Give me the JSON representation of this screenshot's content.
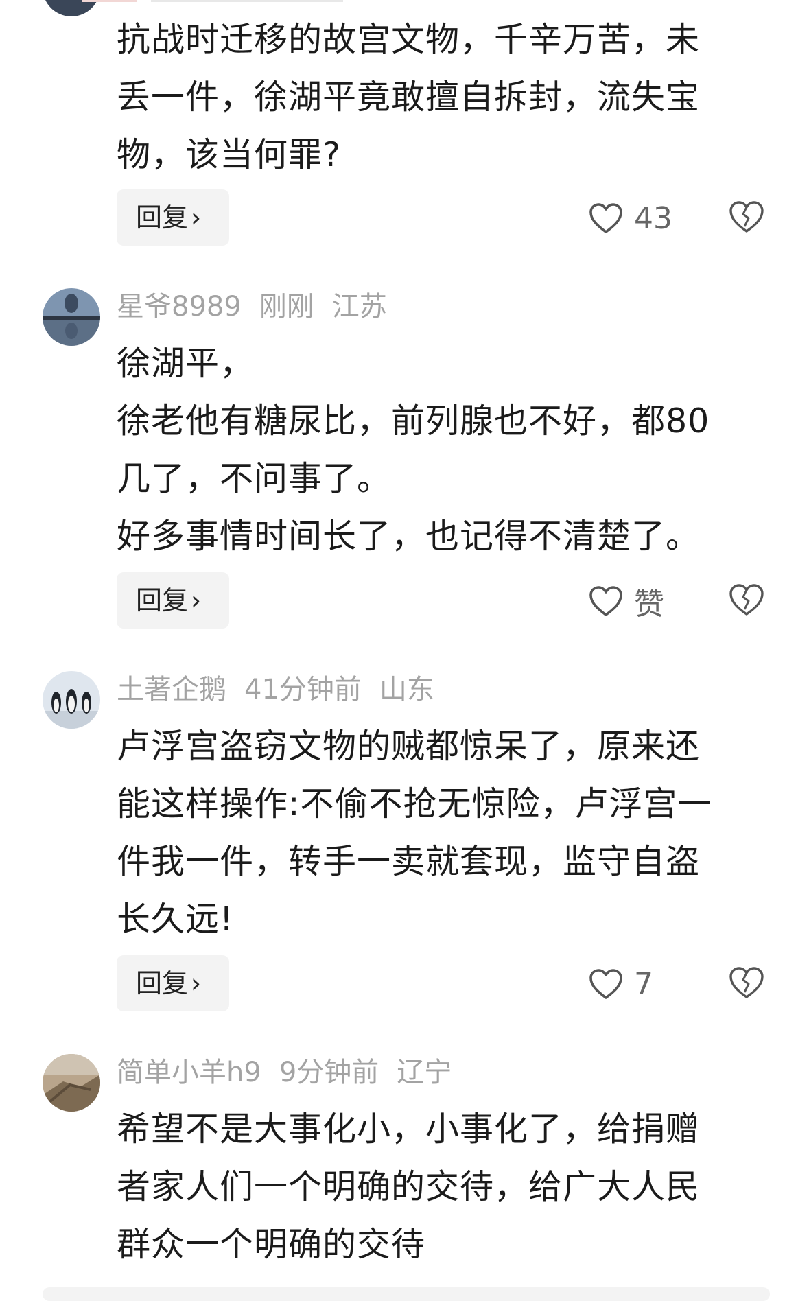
{
  "comments": [
    {
      "text_lines": [
        "抗战时迁移的故宫文物，千辛万苦，未",
        "丢一件，徐湖平竟敢擅自拆封，流失宝",
        "物，该当何罪?"
      ],
      "reply_label": "回复",
      "like_count": "43"
    },
    {
      "username": "星爷8989",
      "time": "刚刚",
      "location": "江苏",
      "text_lines": [
        "徐湖平，",
        "徐老他有糖尿比，前列腺也不好，都80",
        "几了，不问事了。",
        "好多事情时间长了，也记得不清楚了。"
      ],
      "reply_label": "回复",
      "like_count": "赞"
    },
    {
      "username": "土著企鹅",
      "time": "41分钟前",
      "location": "山东",
      "text_lines": [
        "卢浮宫盗窃文物的贼都惊呆了，原来还",
        "能这样操作:不偷不抢无惊险，卢浮宫一",
        "件我一件，转手一卖就套现，监守自盗",
        "长久远!"
      ],
      "reply_label": "回复",
      "like_count": "7"
    },
    {
      "username": "简单小羊h9",
      "time": "9分钟前",
      "location": "辽宁",
      "text_lines": [
        "希望不是大事化小，小事化了，给捐赠",
        "者家人们一个明确的交待，给广大人民",
        "群众一个明确的交待"
      ]
    }
  ],
  "icons": {
    "like": "heart-outline-icon",
    "dislike": "broken-heart-icon",
    "reply_arrow": "chevron-right-icon"
  },
  "colors": {
    "meta_text": "#a3a3a3",
    "body_text": "#1b1b1b",
    "reply_bg": "#f3f3f3"
  }
}
